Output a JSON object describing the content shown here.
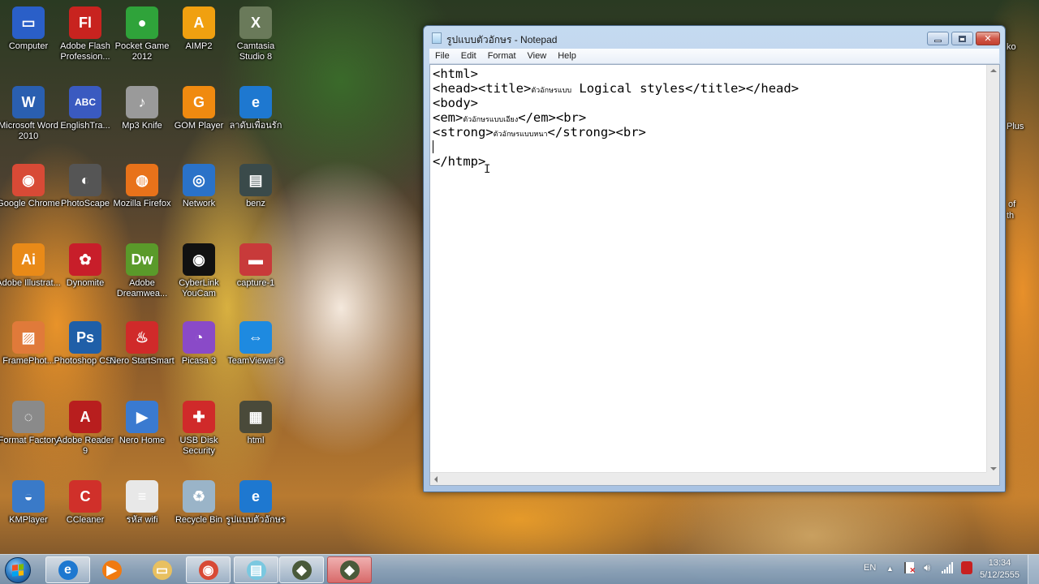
{
  "desktop": {
    "icons": [
      {
        "label": "Computer",
        "icon": "computer-icon",
        "color": "#2a5fc8",
        "glyph": "▭",
        "shortcut": false
      },
      {
        "label": "Adobe Flash Profession...",
        "icon": "adobe-flash-icon",
        "color": "#c8231f",
        "glyph": "Fl",
        "shortcut": true
      },
      {
        "label": "Pocket Game 2012",
        "icon": "pocket-game-icon",
        "color": "#2fa33a",
        "glyph": "●",
        "shortcut": true
      },
      {
        "label": "AIMP2",
        "icon": "aimp-icon",
        "color": "#f0a010",
        "glyph": "A",
        "shortcut": true
      },
      {
        "label": "Camtasia Studio 8",
        "icon": "camtasia-icon",
        "color": "#6a7a5a",
        "glyph": "X",
        "shortcut": true
      },
      {
        "label": "Microsoft Word 2010",
        "icon": "word-icon",
        "color": "#2a5fb0",
        "glyph": "W",
        "shortcut": true
      },
      {
        "label": "EnglishTra...",
        "icon": "english-translator-icon",
        "color": "#3a5ac0",
        "glyph": "ABC",
        "shortcut": true
      },
      {
        "label": "Mp3 Knife",
        "icon": "mp3-knife-icon",
        "color": "#9a9a9a",
        "glyph": "♪",
        "shortcut": true
      },
      {
        "label": "GOM Player",
        "icon": "gom-player-icon",
        "color": "#f08a10",
        "glyph": "G",
        "shortcut": true
      },
      {
        "label": "ลาดับเพื่อนรัก",
        "icon": "internet-explorer-icon",
        "color": "#1e78d0",
        "glyph": "e",
        "shortcut": false
      },
      {
        "label": "Google Chrome",
        "icon": "chrome-icon",
        "color": "#d84a36",
        "glyph": "◉",
        "shortcut": true
      },
      {
        "label": "PhotoScape",
        "icon": "photoscape-icon",
        "color": "#555555",
        "glyph": "◐",
        "shortcut": true
      },
      {
        "label": "Mozilla Firefox",
        "icon": "firefox-icon",
        "color": "#e8721a",
        "glyph": "◍",
        "shortcut": true
      },
      {
        "label": "Network",
        "icon": "network-icon",
        "color": "#2a72c8",
        "glyph": "◎",
        "shortcut": false
      },
      {
        "label": "benz",
        "icon": "folder-icon",
        "color": "#3a4a4a",
        "glyph": "▤",
        "shortcut": false
      },
      {
        "label": "Adobe Illustrat...",
        "icon": "illustrator-icon",
        "color": "#e98a18",
        "glyph": "Ai",
        "shortcut": true
      },
      {
        "label": "Dynomite",
        "icon": "dynomite-icon",
        "color": "#c81e2a",
        "glyph": "✿",
        "shortcut": true
      },
      {
        "label": "Adobe Dreamwea...",
        "icon": "dreamweaver-icon",
        "color": "#5a9a2a",
        "glyph": "Dw",
        "shortcut": true
      },
      {
        "label": "CyberLink YouCam",
        "icon": "youcam-icon",
        "color": "#111111",
        "glyph": "◉",
        "shortcut": true
      },
      {
        "label": "capture-1",
        "icon": "video-file-icon",
        "color": "#c83a3a",
        "glyph": "▬",
        "shortcut": false
      },
      {
        "label": "FramePhot...",
        "icon": "framephoto-icon",
        "color": "#e07a3a",
        "glyph": "▨",
        "shortcut": true
      },
      {
        "label": "Photoshop CS5",
        "icon": "photoshop-icon",
        "color": "#1f5fa8",
        "glyph": "Ps",
        "shortcut": true
      },
      {
        "label": "Nero StartSmart",
        "icon": "nero-icon",
        "color": "#d02a2a",
        "glyph": "♨",
        "shortcut": true
      },
      {
        "label": "Picasa 3",
        "icon": "picasa-icon",
        "color": "#8a4ac8",
        "glyph": "◔",
        "shortcut": true
      },
      {
        "label": "TeamViewer 8",
        "icon": "teamviewer-icon",
        "color": "#1e8ae0",
        "glyph": "⇔",
        "shortcut": true
      },
      {
        "label": "Format Factory",
        "icon": "format-factory-icon",
        "color": "#8a8a8a",
        "glyph": "◌",
        "shortcut": true
      },
      {
        "label": "Adobe Reader 9",
        "icon": "adobe-reader-icon",
        "color": "#b81e1e",
        "glyph": "A",
        "shortcut": true
      },
      {
        "label": "Nero Home",
        "icon": "nero-home-icon",
        "color": "#3a7ad0",
        "glyph": "▶",
        "shortcut": true
      },
      {
        "label": "USB Disk Security",
        "icon": "usb-disk-security-icon",
        "color": "#d02a2a",
        "glyph": "✚",
        "shortcut": true
      },
      {
        "label": "html",
        "icon": "video-thumbnail-icon",
        "color": "#4a4a3a",
        "glyph": "▦",
        "shortcut": false
      },
      {
        "label": "KMPlayer",
        "icon": "kmplayer-icon",
        "color": "#3a7ac8",
        "glyph": "◒",
        "shortcut": true
      },
      {
        "label": "CCleaner",
        "icon": "ccleaner-icon",
        "color": "#d0302a",
        "glyph": "C",
        "shortcut": true
      },
      {
        "label": "รหัส wifi",
        "icon": "text-file-icon",
        "color": "#e8e8e8",
        "glyph": "≡",
        "shortcut": false
      },
      {
        "label": "Recycle Bin",
        "icon": "recycle-bin-icon",
        "color": "#9ab4c8",
        "glyph": "♻",
        "shortcut": false
      },
      {
        "label": "รูปแบบตัวอักษร",
        "icon": "internet-explorer-icon",
        "color": "#1e78d0",
        "glyph": "e",
        "shortcut": false
      }
    ],
    "edge_labels": [
      "ko",
      "Plus",
      "of",
      "th"
    ]
  },
  "notepad": {
    "title": "รูปแบบตัวอักษร - Notepad",
    "menu": [
      "File",
      "Edit",
      "Format",
      "View",
      "Help"
    ],
    "lines": [
      {
        "code": "<html>"
      },
      {
        "pre": "<head><title>",
        "thai": "ตัวอักษรแบบ",
        "post": " Logical styles</title></head>"
      },
      {
        "code": "<body>"
      },
      {
        "pre": "<em>",
        "thai": "ตัวอักษรแบบเอียง",
        "post": "</em><br>"
      },
      {
        "pre": "<strong>",
        "thai": "ตัวอักษรแบบหนา",
        "post": "</strong><br>"
      },
      {
        "code": ""
      },
      {
        "code": "</htmp>"
      }
    ],
    "buttons": {
      "minimize": "minimize",
      "maximize": "maximize",
      "close": "✕"
    }
  },
  "taskbar": {
    "apps": [
      {
        "name": "internet-explorer",
        "glyph": "e",
        "color": "#1e78d0",
        "state": "open"
      },
      {
        "name": "windows-media-player",
        "glyph": "▶",
        "color": "#f07a10",
        "state": "pinned"
      },
      {
        "name": "windows-explorer",
        "glyph": "▭",
        "color": "#e8c060",
        "state": "pinned"
      },
      {
        "name": "google-chrome",
        "glyph": "◉",
        "color": "#d84a36",
        "state": "open"
      },
      {
        "name": "notepad",
        "glyph": "▤",
        "color": "#7ac8e0",
        "state": "open"
      },
      {
        "name": "camtasia-recorder",
        "glyph": "◆",
        "color": "#4a5a3a",
        "state": "open"
      },
      {
        "name": "camtasia-recording",
        "glyph": "◆",
        "color": "#4a5a3a",
        "state": "active"
      }
    ],
    "tray": {
      "language": "EN",
      "show_hidden": "▲",
      "clock_time": "13:34",
      "clock_date": "5/12/2555"
    }
  }
}
